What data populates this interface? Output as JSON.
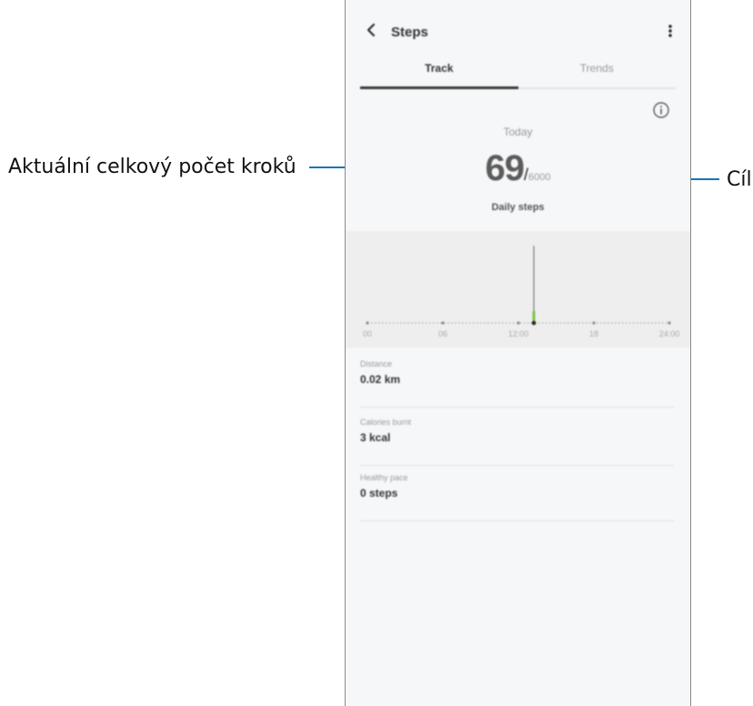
{
  "callouts": {
    "left": "Aktuální celkový počet kroků",
    "right": "Cíl"
  },
  "header": {
    "title": "Steps"
  },
  "tabs": [
    {
      "label": "Track"
    },
    {
      "label": "Trends"
    }
  ],
  "summary": {
    "day": "Today",
    "count": "69",
    "separator": "/",
    "goal": "6000",
    "label": "Daily steps"
  },
  "chart_data": {
    "type": "bar",
    "tick_labels": [
      "00",
      "06",
      "12:00",
      "18",
      "24:00"
    ],
    "marker_tick": "12:00"
  },
  "details": [
    {
      "title": "Distance",
      "value": "0.02 km"
    },
    {
      "title": "Calories burnt",
      "value": "3 kcal"
    },
    {
      "title": "Healthy pace",
      "value": "0 steps"
    }
  ]
}
